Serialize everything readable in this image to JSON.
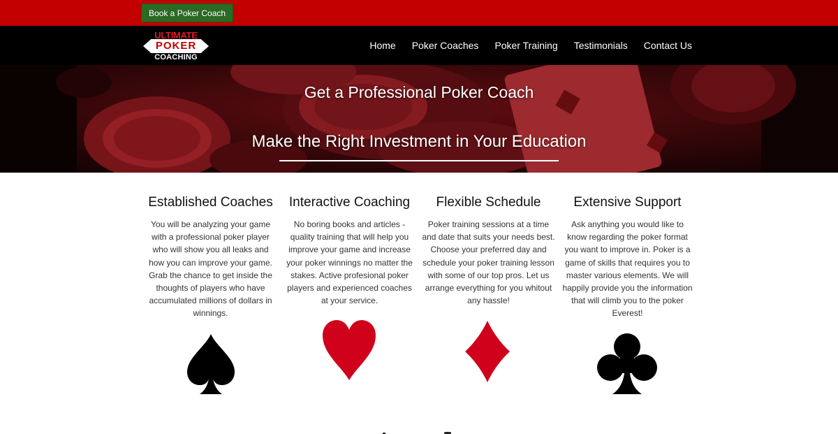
{
  "topbar": {
    "book_button": "Book a Poker Coach",
    "color": "#c20000"
  },
  "logo": {
    "line1": "ULTIMATE",
    "line2": "POKER",
    "line3": "COACHING"
  },
  "nav": {
    "items": [
      {
        "label": "Home"
      },
      {
        "label": "Poker Coaches"
      },
      {
        "label": "Poker Training"
      },
      {
        "label": "Testimonials"
      },
      {
        "label": "Contact Us"
      }
    ]
  },
  "hero": {
    "title": "Get a Professional Poker Coach",
    "subtitle": "Make the Right Investment in Your Education"
  },
  "features": [
    {
      "title": "Established Coaches",
      "text": "You will be analyzing your game with a professional poker player who will show you all leaks and how you can improve your game. Grab the chance to get inside the thoughts of players who have accumulated millions of dollars in winnings.",
      "icon": "spade-icon",
      "color": "#000000"
    },
    {
      "title": "Interactive Coaching",
      "text": "No boring books and articles - quality training that will help you improve your game and increase your poker winnings no matter the stakes. Active profesional poker players and experienced coaches at your service.",
      "icon": "heart-icon",
      "color": "#d0021b"
    },
    {
      "title": "Flexible Schedule",
      "text": "Poker training sessions at a time and date that suits your needs best. Choose your preferred day and schedule your poker training lesson with some of our top pros. Let us arrange everything for you whitout any hassle!",
      "icon": "diamond-icon",
      "color": "#d0021b"
    },
    {
      "title": "Extensive Support",
      "text": "Ask anything you would like to know regarding the poker format you want to improve in. Poker is a game of skills that requires you to master various elements. We will happily provide you the information that will climb you to the poker Everest!",
      "icon": "club-icon",
      "color": "#000000"
    }
  ],
  "colors": {
    "accent": "#c20000",
    "button": "#2a6a23",
    "nav_bg": "#000000"
  }
}
